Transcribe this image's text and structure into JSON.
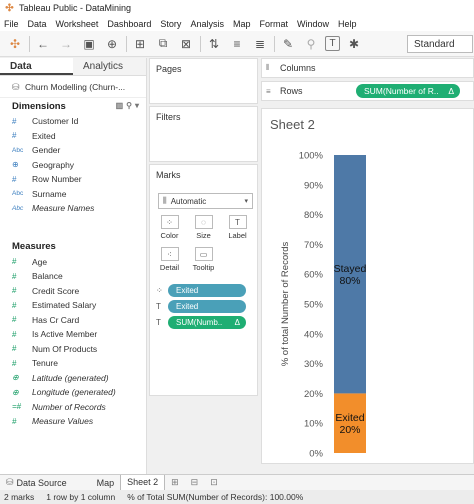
{
  "window": {
    "title": "Tableau Public - DataMining"
  },
  "menu": [
    "File",
    "Data",
    "Worksheet",
    "Dashboard",
    "Story",
    "Analysis",
    "Map",
    "Format",
    "Window",
    "Help"
  ],
  "toolbar": {
    "view_mode": "Standard"
  },
  "data_pane": {
    "tabs": {
      "data": "Data",
      "analytics": "Analytics"
    },
    "datasource": "Churn Modelling (Churn-...",
    "dimensions_title": "Dimensions",
    "dimensions": [
      {
        "label": "Customer Id",
        "type": "#"
      },
      {
        "label": "Exited",
        "type": "#"
      },
      {
        "label": "Gender",
        "type": "Abc"
      },
      {
        "label": "Geography",
        "type": "globe"
      },
      {
        "label": "Row Number",
        "type": "#"
      },
      {
        "label": "Surname",
        "type": "Abc"
      },
      {
        "label": "Measure Names",
        "type": "Abc"
      }
    ],
    "measures_title": "Measures",
    "measures": [
      {
        "label": "Age",
        "type": "#"
      },
      {
        "label": "Balance",
        "type": "#"
      },
      {
        "label": "Credit Score",
        "type": "#"
      },
      {
        "label": "Estimated Salary",
        "type": "#"
      },
      {
        "label": "Has Cr Card",
        "type": "#"
      },
      {
        "label": "Is Active Member",
        "type": "#"
      },
      {
        "label": "Num Of Products",
        "type": "#"
      },
      {
        "label": "Tenure",
        "type": "#"
      },
      {
        "label": "Latitude (generated)",
        "type": "globe"
      },
      {
        "label": "Longitude (generated)",
        "type": "globe"
      },
      {
        "label": "Number of Records",
        "type": "=#"
      },
      {
        "label": "Measure Values",
        "type": "#"
      }
    ]
  },
  "cards": {
    "pages": "Pages",
    "filters": "Filters",
    "marks": "Marks",
    "mark_type": "Automatic",
    "mark_buttons": {
      "color": "Color",
      "size": "Size",
      "label": "Label",
      "detail": "Detail",
      "tooltip": "Tooltip"
    },
    "mark_pills": {
      "color_pill": "Exited",
      "label_pill": "Exited",
      "value_pill": "SUM(Numb..",
      "delta": "Δ"
    }
  },
  "shelves": {
    "columns": "Columns",
    "rows": "Rows",
    "rows_pill": "SUM(Number of R..",
    "rows_delta": "Δ"
  },
  "sheet": {
    "title": "Sheet 2"
  },
  "chart_data": {
    "type": "bar",
    "stacked": true,
    "ylabel": "% of total Number of Records",
    "ylim": [
      0,
      100
    ],
    "yticks": [
      "0%",
      "10%",
      "20%",
      "30%",
      "40%",
      "50%",
      "60%",
      "70%",
      "80%",
      "90%",
      "100%"
    ],
    "series": [
      {
        "name": "Exited",
        "value": 20,
        "label": "Exited\n20%",
        "label_lines": [
          "Exited",
          "20%"
        ],
        "color": "#f28e2b"
      },
      {
        "name": "Stayed",
        "value": 80,
        "label": "Stayed\n80%",
        "label_lines": [
          "Stayed",
          "80%"
        ],
        "color": "#4e79a7"
      }
    ]
  },
  "bottom_tabs": {
    "datasource": "Data Source",
    "map": "Map",
    "sheet2": "Sheet 2"
  },
  "status": {
    "marks": "2 marks",
    "rows_cols": "1 row by 1 column",
    "summary": "% of Total SUM(Number of Records): 100.00%"
  }
}
